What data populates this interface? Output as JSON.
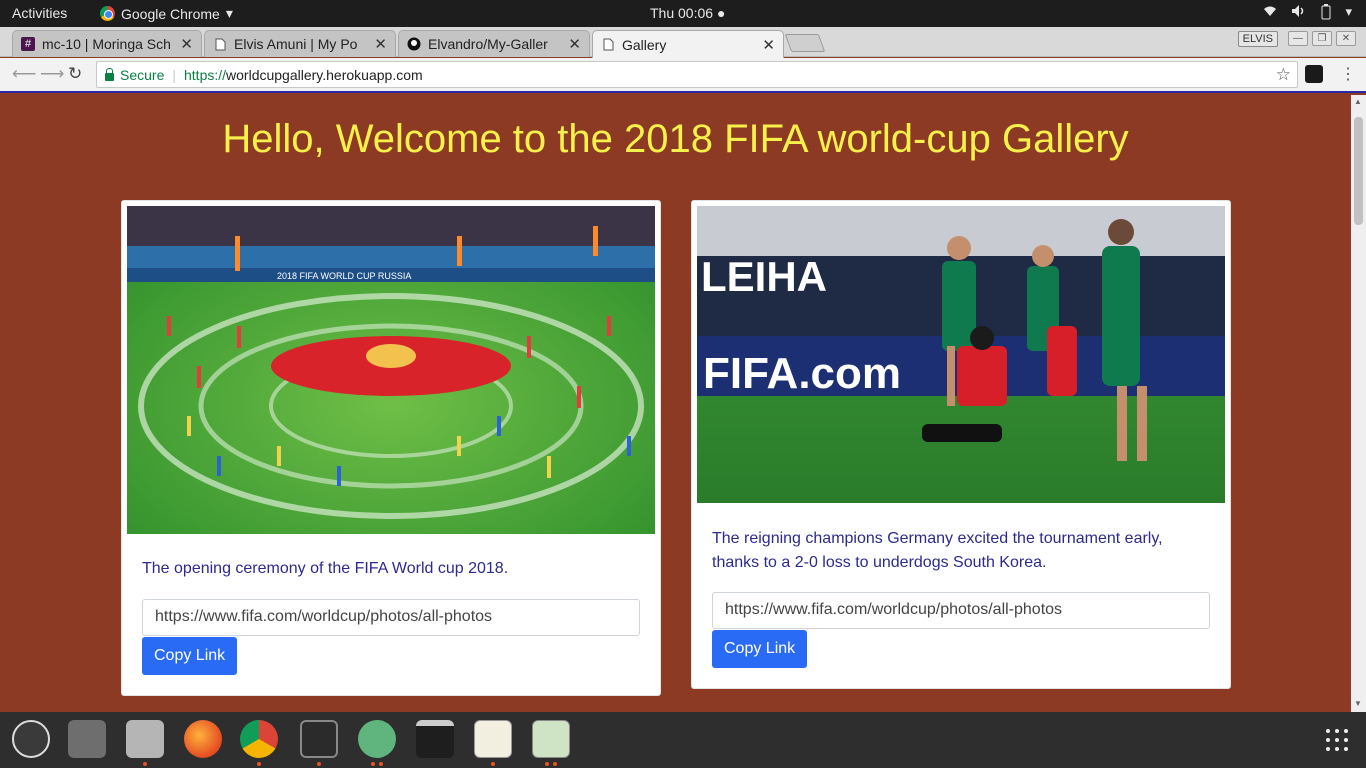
{
  "topbar": {
    "activities": "Activities",
    "app_name": "Google Chrome",
    "app_caret": "▾",
    "clock": "Thu 00:06 ●"
  },
  "tabs": [
    {
      "title": "mc-10 | Moringa Sch",
      "favicon": "#"
    },
    {
      "title": "Elvis Amuni | My Po",
      "favicon": "doc"
    },
    {
      "title": "Elvandro/My-Galler",
      "favicon": "github"
    },
    {
      "title": "Gallery",
      "favicon": "doc"
    }
  ],
  "window": {
    "user_badge": "ELVIS"
  },
  "omnibox": {
    "secure_label": "Secure",
    "scheme": "https://",
    "host": "worldcupgallery.herokuapp.com"
  },
  "page": {
    "heading": "Hello, Welcome to the 2018 FIFA world-cup Gallery",
    "cards": [
      {
        "caption": "The opening ceremony of the FIFA World cup 2018.",
        "link": "https://www.fifa.com/worldcup/photos/all-photos",
        "button": "Copy Link",
        "photo_banner": "2018 FIFA WORLD CUP RUSSIA"
      },
      {
        "caption": "The reigning champions Germany excited the tournament early, thanks to a 2-0 loss to underdogs South Korea.",
        "link": "https://www.fifa.com/worldcup/photos/all-photos",
        "button": "Copy Link",
        "photo_banner": "FIFA.com"
      }
    ]
  },
  "colors": {
    "page_bg": "#8d3a24",
    "heading": "#f6f04a",
    "caption": "#2c2a8e",
    "button": "#2a6bf6"
  }
}
